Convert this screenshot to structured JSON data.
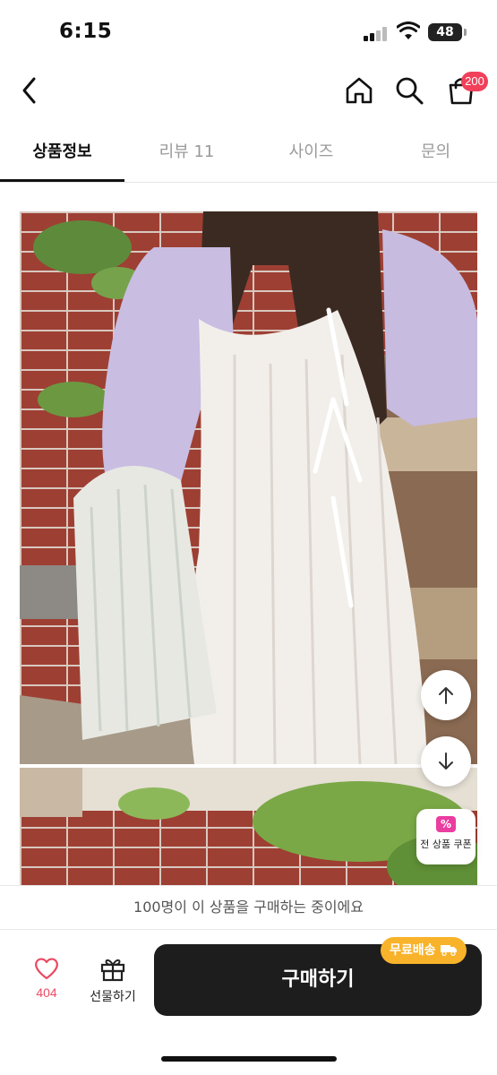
{
  "status_bar": {
    "time": "6:15",
    "battery": "48"
  },
  "nav": {
    "back_icon": "chevron-left-icon",
    "home_icon": "home-icon",
    "search_icon": "search-icon",
    "cart_icon": "shopping-bag-icon",
    "cart_badge": "200"
  },
  "tabs": [
    {
      "label": "상품정보",
      "active": true
    },
    {
      "label": "리뷰 11",
      "active": false
    },
    {
      "label": "사이즈",
      "active": false
    },
    {
      "label": "문의",
      "active": false
    }
  ],
  "floating": {
    "scroll_up_icon": "arrow-up-icon",
    "scroll_down_icon": "arrow-down-icon",
    "coupon_label": "전 상품 쿠폰",
    "coupon_icon_text": "%"
  },
  "buyers_message": "100명이 이 상품을 구매하는 중이에요",
  "bottom": {
    "like_count": "404",
    "gift_label": "선물하기",
    "buy_label": "구매하기",
    "free_shipping_label": "무료배송"
  },
  "colors": {
    "accent_pink": "#f0405a",
    "buy_button": "#1d1d1d",
    "free_shipping": "#f8b32b"
  }
}
